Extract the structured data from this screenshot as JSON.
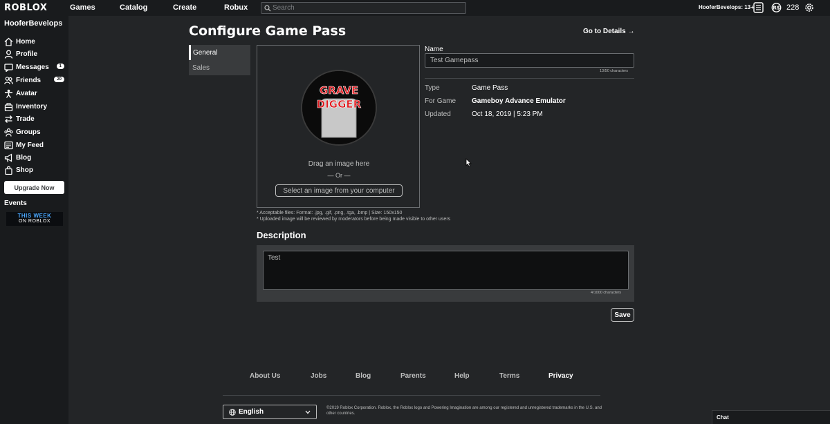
{
  "topbar": {
    "logo": "ROBLOX",
    "nav": [
      "Games",
      "Catalog",
      "Create",
      "Robux"
    ],
    "search_placeholder": "Search",
    "username": "HooferBevelops: 13+",
    "robux": "228"
  },
  "sidebar": {
    "username": "HooferBevelops",
    "items": [
      {
        "label": "Home",
        "icon": "home-icon"
      },
      {
        "label": "Profile",
        "icon": "profile-icon"
      },
      {
        "label": "Messages",
        "icon": "messages-icon",
        "badge": "1"
      },
      {
        "label": "Friends",
        "icon": "friends-icon",
        "badge": "20"
      },
      {
        "label": "Avatar",
        "icon": "avatar-icon"
      },
      {
        "label": "Inventory",
        "icon": "inventory-icon"
      },
      {
        "label": "Trade",
        "icon": "trade-icon"
      },
      {
        "label": "Groups",
        "icon": "groups-icon"
      },
      {
        "label": "My Feed",
        "icon": "feed-icon"
      },
      {
        "label": "Blog",
        "icon": "blog-icon"
      },
      {
        "label": "Shop",
        "icon": "shop-icon"
      }
    ],
    "upgrade": "Upgrade Now",
    "events": "Events",
    "events_banner_line1": "THIS WEEK",
    "events_banner_line2": "ON ROBLOX"
  },
  "page": {
    "title": "Configure Game Pass",
    "details_link": "Go to Details →",
    "tabs": [
      "General",
      "Sales"
    ],
    "upload": {
      "image_text_line1": "GRAVE",
      "image_text_line2": "DIGGER",
      "drag": "Drag an image here",
      "or": "— Or —",
      "select": "Select an image from your computer",
      "note1": "* Acceptable files: Format: .jpg, .gif, .png, .tga, .bmp | Size: 150x150",
      "note2": "* Uploaded image will be reviewed by moderators before being made visible to other users"
    },
    "name": {
      "label": "Name",
      "value": "Test Gamepass",
      "count": "13/50 characters"
    },
    "info": [
      {
        "label": "Type",
        "value": "Game Pass"
      },
      {
        "label": "For Game",
        "value": "Gameboy Advance Emulator"
      },
      {
        "label": "Updated",
        "value": "Oct 18, 2019 | 5:23 PM"
      }
    ],
    "description": {
      "title": "Description",
      "value": "Test",
      "count": "4/1000 characters"
    },
    "save": "Save"
  },
  "footer": {
    "links": [
      "About Us",
      "Jobs",
      "Blog",
      "Parents",
      "Help",
      "Terms",
      "Privacy"
    ],
    "language": "English",
    "copyright": "©2019 Roblox Corporation. Roblox, the Roblox logo and Powering Imagination are among our registered and unregistered trademarks in the U.S. and other countries."
  },
  "chat": "Chat",
  "colors": {
    "background": "#232527",
    "bars": "#191b1d",
    "panel": "#393b3d",
    "image_text": "#e0191e"
  }
}
